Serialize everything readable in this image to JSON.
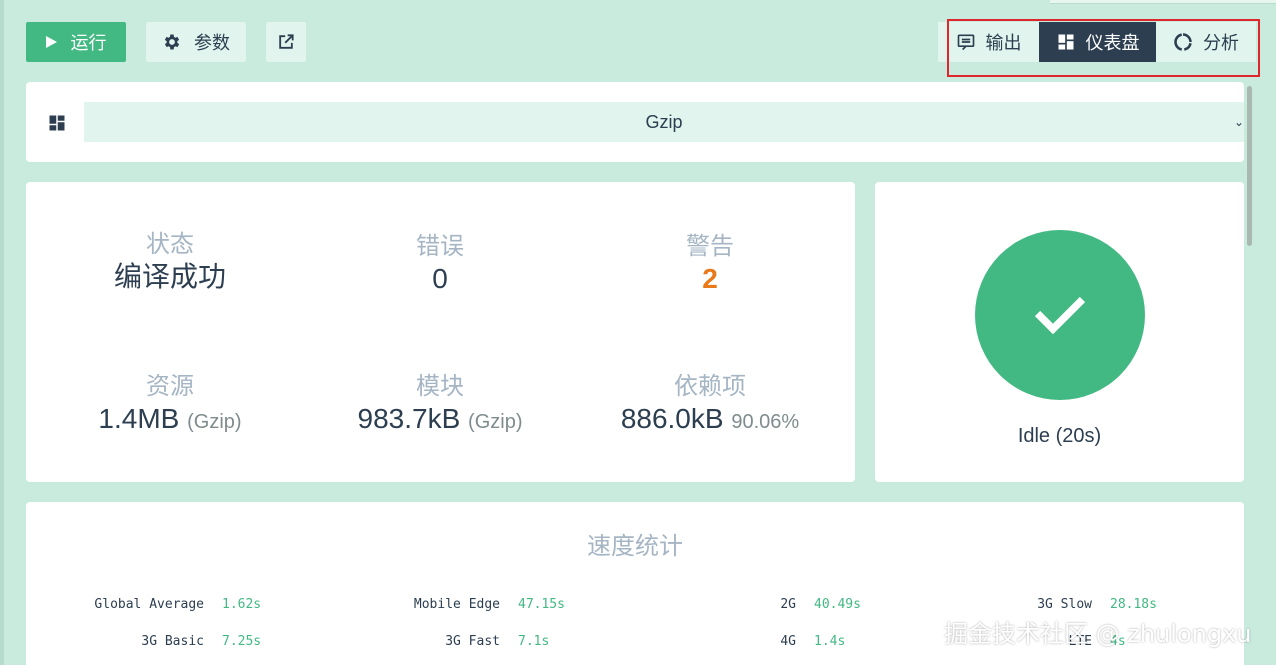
{
  "toolbar": {
    "run_label": "运行",
    "params_label": "参数",
    "open_icon": "external-link-icon"
  },
  "views": {
    "output_label": "输出",
    "dashboard_label": "仪表盘",
    "analysis_label": "分析",
    "active": "dashboard"
  },
  "select": {
    "value": "Gzip",
    "arrow": "⌄"
  },
  "stats": {
    "status_label": "状态",
    "status_value": "编译成功",
    "errors_label": "错误",
    "errors_value": "0",
    "warnings_label": "警告",
    "warnings_value": "2",
    "assets_label": "资源",
    "assets_value": "1.4MB",
    "assets_sub": "(Gzip)",
    "modules_label": "模块",
    "modules_value": "983.7kB",
    "modules_sub": "(Gzip)",
    "deps_label": "依赖项",
    "deps_value": "886.0kB",
    "deps_sub": "90.06%"
  },
  "status_panel": {
    "text": "Idle (20s)"
  },
  "speed": {
    "title": "速度统计",
    "items": [
      {
        "name": "Global Average",
        "value": "1.62s"
      },
      {
        "name": "Mobile Edge",
        "value": "47.15s"
      },
      {
        "name": "2G",
        "value": "40.49s"
      },
      {
        "name": "3G Slow",
        "value": "28.18s"
      },
      {
        "name": "3G Basic",
        "value": "7.25s"
      },
      {
        "name": "3G Fast",
        "value": "7.1s"
      },
      {
        "name": "4G",
        "value": "1.4s"
      },
      {
        "name": "LTE",
        "value": "4s"
      }
    ]
  },
  "watermark": "掘金技术社区 @ zhulongxu",
  "colors": {
    "accent": "#42b983",
    "dark": "#2c3e50",
    "warning": "#e87a1c",
    "background": "#c9ebde",
    "highlight": "#e0262d"
  }
}
